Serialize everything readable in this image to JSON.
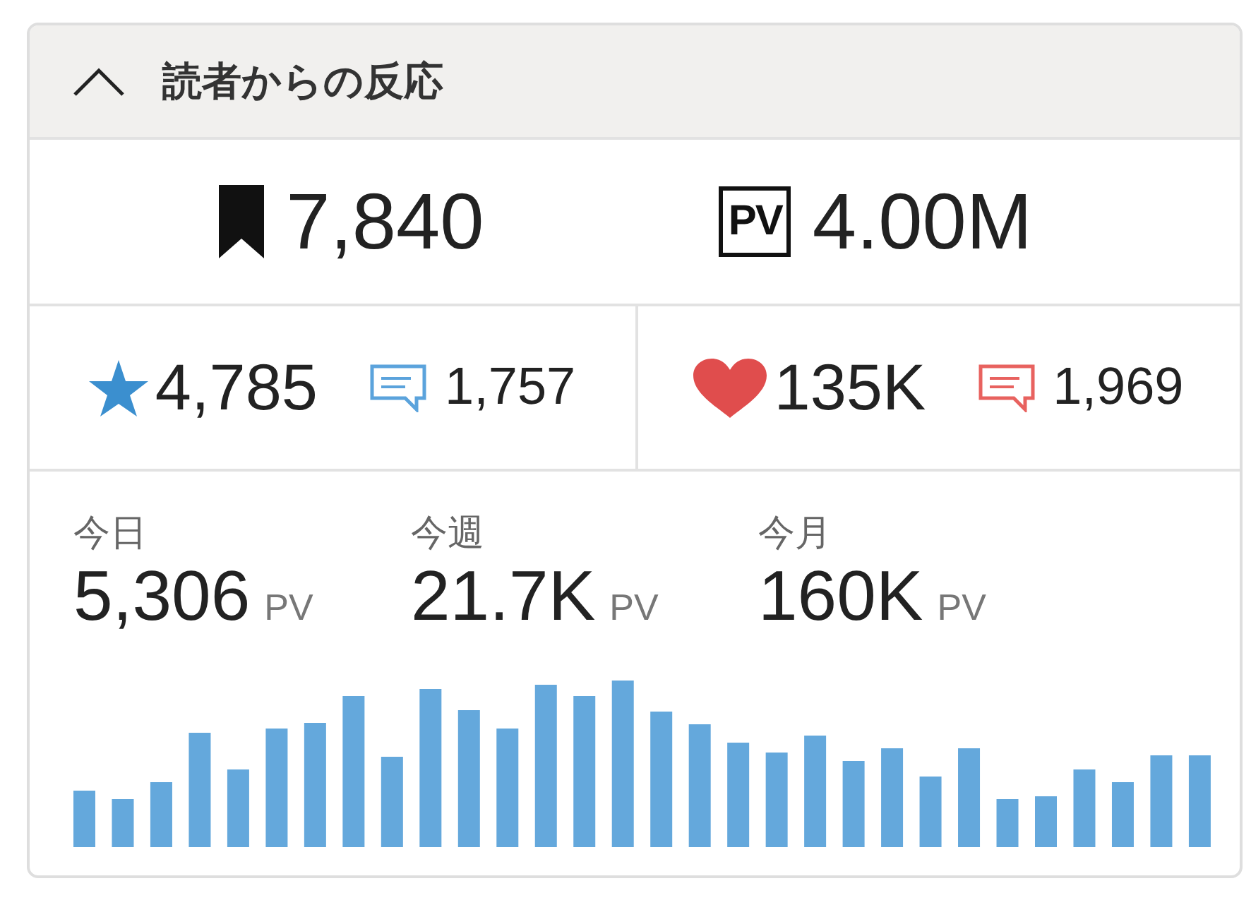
{
  "panel": {
    "title": "読者からの反応",
    "expanded": true
  },
  "totals": [
    {
      "kind": "bookmark",
      "value": "7,840"
    },
    {
      "kind": "pageviews",
      "badge": "PV",
      "value": "4.00M"
    }
  ],
  "reactions": [
    {
      "items": [
        {
          "kind": "star",
          "color": "#3b8fcf",
          "value": "4,785"
        },
        {
          "kind": "comment",
          "color": "#5ba3dc",
          "value": "1,757"
        }
      ]
    },
    {
      "items": [
        {
          "kind": "heart",
          "color": "#e04d4d",
          "value": "135K"
        },
        {
          "kind": "comment",
          "color": "#e8625f",
          "value": "1,969"
        }
      ]
    }
  ],
  "periods": [
    {
      "label": "今日",
      "value": "5,306",
      "unit": "PV"
    },
    {
      "label": "今週",
      "value": "21.7K",
      "unit": "PV"
    },
    {
      "label": "今月",
      "value": "160K",
      "unit": "PV"
    }
  ]
}
